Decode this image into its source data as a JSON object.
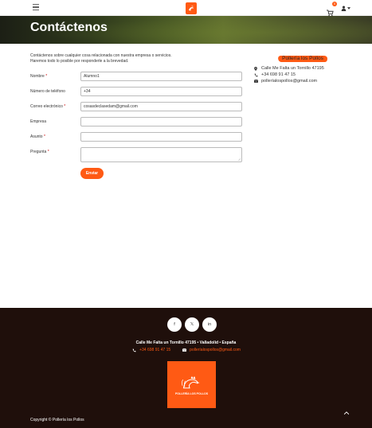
{
  "header": {
    "cart_count": "0",
    "icons": {
      "menu": "hamburger-icon",
      "cart": "cart-icon",
      "user": "user-icon",
      "logo": "rooster-logo"
    }
  },
  "hero": {
    "title": "Contáctenos"
  },
  "intro": {
    "line1": "Contáctenos sobre cualquier cosa relacionada con nuestra empresa o servicios.",
    "line2": "Haremos todo lo posible por responderle a la brevedad."
  },
  "form": {
    "name": {
      "label": "Nombre",
      "required": "*",
      "value": "Alumno1"
    },
    "phone": {
      "label": "Número de teléfono",
      "required": "",
      "value": "+34"
    },
    "email": {
      "label": "Correo electrónico",
      "required": "*",
      "value": "cosasdeclasedam@gmail.com"
    },
    "company": {
      "label": "Empresa",
      "required": "",
      "value": ""
    },
    "subject": {
      "label": "Asunto",
      "required": "*",
      "value": ""
    },
    "question": {
      "label": "Pregunta",
      "required": "*",
      "value": ""
    },
    "submit_label": "Enviar"
  },
  "sidebar": {
    "brand": "Pollería los Pollos",
    "address": "Calle Me Falta un Tornillo 47195",
    "phone": "+34 698 91 47 15",
    "email": "polleríalospollos@gmail.com"
  },
  "footer": {
    "social": {
      "facebook": "f",
      "twitter": "𝕏",
      "linkedin": "in"
    },
    "address": "Calle Me Falta un Tornillo 47195 • Valladolid • España",
    "phone": "+34 698 91 47 15",
    "email": "polleríalospollos@gmail.com",
    "logo_text": "POLLERÍA LOS POLLOS",
    "copyright": "Copyright © Pollería los Pollos"
  },
  "colors": {
    "accent": "#ff5a14",
    "footer_bg": "#1f0f0b"
  }
}
